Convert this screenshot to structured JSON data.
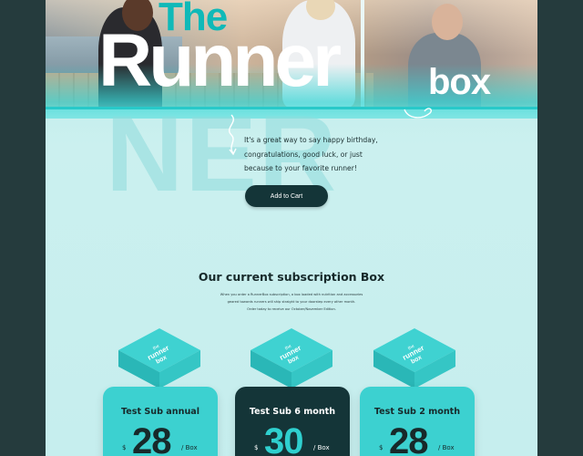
{
  "hero": {
    "title_the": "The",
    "title_runner_main": "Runner",
    "title_box": "box",
    "background_letters": "NER",
    "tagline_lines": [
      "It's a great way to say happy birthday,",
      "congratulations, good luck, or just",
      "because to your favorite runner!"
    ],
    "add_to_cart_label": "Add to Cart"
  },
  "subscriptions": {
    "title": "Our current subscription Box",
    "description_lines": [
      "When you order a RunnerBox subscription, a box loaded with nutrition and accessories",
      "geared towards runners will ship straight to your doorstep every other month.",
      "Order today to receive our October/November Edition."
    ],
    "box_logo_line1": "the",
    "box_logo_line2": "runner",
    "box_logo_line3": "box",
    "plans": [
      {
        "name": "Test Sub annual",
        "currency": "$",
        "price": "28",
        "unit": "/ Box"
      },
      {
        "name": "Test Sub 6 month",
        "currency": "$",
        "price": "30",
        "unit": "/ Box"
      },
      {
        "name": "Test Sub 2 month",
        "currency": "$",
        "price": "28",
        "unit": "/ Box"
      }
    ]
  },
  "colors": {
    "accent": "#2fd0cf",
    "dark": "#143538",
    "frame": "#253b3d"
  }
}
